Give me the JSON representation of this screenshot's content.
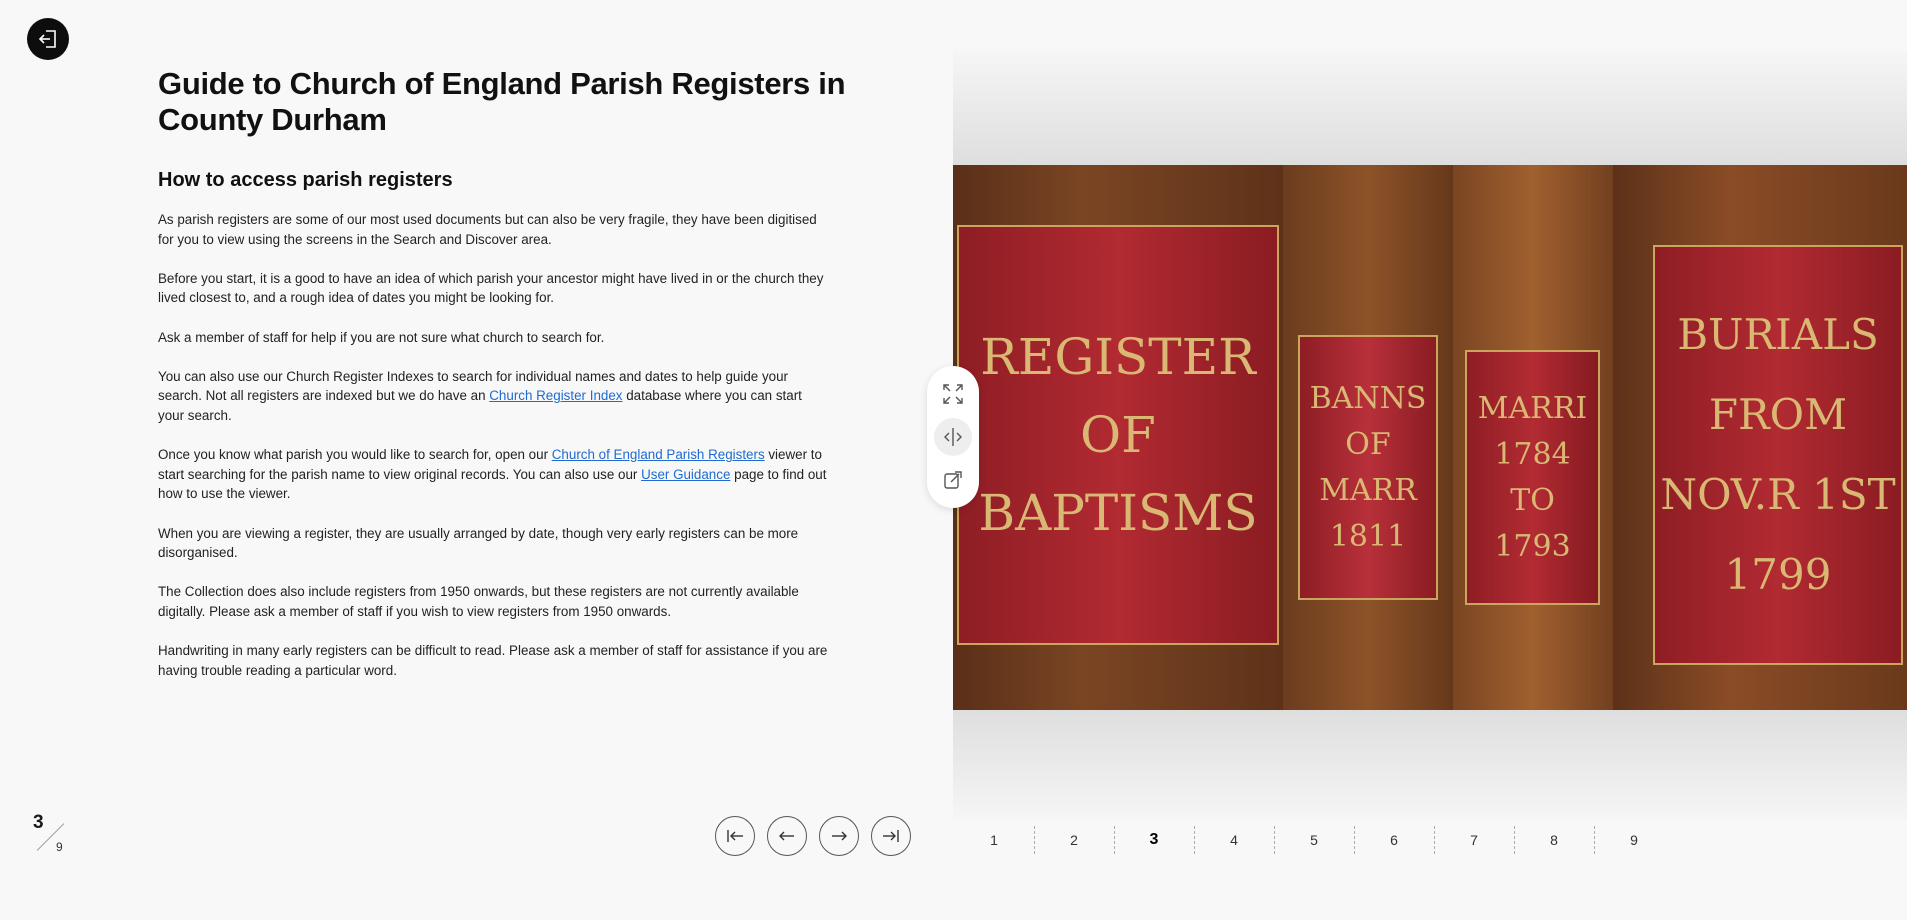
{
  "header": {
    "title": "Guide to Church of England Parish Registers in County Durham",
    "subtitle": "How to access parish registers"
  },
  "content": {
    "p1": "As parish registers are some of our most used documents but can also be very fragile, they have been digitised for you to view using the screens in the Search and Discover area.",
    "p2": "Before you start, it is a good to have an idea of which parish your ancestor might have lived in or the church they lived closest to, and a rough idea of dates you might be looking for.",
    "p3": "Ask a member of staff for help if you are not sure what church to search for.",
    "p4_before": "You can also use our Church Register Indexes to search for individual names and dates to help guide your search. Not all registers are indexed but we do have an ",
    "p4_link": "Church Register Index",
    "p4_after": " database where you can start your search.",
    "p5_before": "Once you know what parish you would like to search for, open our ",
    "p5_link1": "Church of England Parish Registers",
    "p5_mid": " viewer to start searching for the parish name to view original records. You can also use our ",
    "p5_link2": "User Guidance",
    "p5_after": " page to find out how to use the viewer.",
    "p6": "When you are viewing a register, they are usually arranged by date, though very early registers can be more disorganised.",
    "p7": "The Collection does also include registers from 1950 onwards, but these registers are not currently available digitally. Please ask a member of staff if you wish to view registers from 1950 onwards.",
    "p8": "Handwriting in many early registers can be difficult to read. Please ask a member of staff for assistance if you are having trouble reading a particular word."
  },
  "image": {
    "book1": {
      "line1": "REGISTER",
      "line2": "OF",
      "line3": "BAPTISMS"
    },
    "book2": {
      "line1": "BANNS",
      "line2": "OF",
      "line3": "MARR",
      "line4": "1811"
    },
    "book3": {
      "line1": "MARRI",
      "line2": "1784",
      "line3": "TO",
      "line4": "1793"
    },
    "book4": {
      "line1": "BURIALS",
      "line2": "FROM",
      "line3": "NOV.R 1ST",
      "line4": "1799"
    }
  },
  "toolbar": {
    "icons": [
      "expand-icon",
      "compare-icon",
      "link-icon"
    ]
  },
  "page_counter": {
    "current": "3",
    "total": "9"
  },
  "nav": {
    "icons": [
      "first-page-icon",
      "previous-icon",
      "next-icon",
      "last-page-icon"
    ]
  },
  "pagination": {
    "pages": [
      "1",
      "2",
      "3",
      "4",
      "5",
      "6",
      "7",
      "8",
      "9"
    ],
    "current": "3"
  },
  "colors": {
    "background": "#f8f8f8",
    "link": "#1f6bd1",
    "exit_button": "#0d0d0d"
  }
}
